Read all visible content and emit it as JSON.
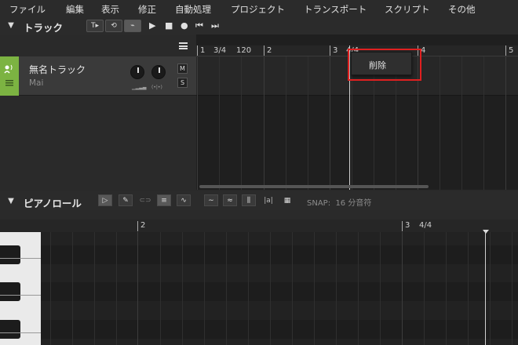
{
  "menu": {
    "items": [
      "ファイル",
      "編集",
      "表示",
      "修正",
      "自動処理",
      "プロジェクト",
      "トランスポート",
      "スクリプト",
      "その他"
    ]
  },
  "tracks_section": {
    "title": "トラック",
    "tool_labels": [
      "T▸",
      "⟲",
      "⌁"
    ]
  },
  "track": {
    "name": "無名トラック",
    "instrument": "Mai",
    "mute_label": "M",
    "solo_label": "S",
    "knob1_label": "▁▂▃▄",
    "knob2_label": "(•|•)"
  },
  "ruler": {
    "labels": [
      "1",
      "3/4",
      "120",
      "2",
      "3",
      "4/4",
      "4",
      "5"
    ]
  },
  "context_menu": {
    "items": [
      "削除"
    ]
  },
  "piano_roll": {
    "title": "ピアノロール",
    "snap_label": "SNAP:",
    "snap_value": "16 分音符",
    "ruler_labels": [
      "2",
      "3",
      "4/4"
    ]
  }
}
